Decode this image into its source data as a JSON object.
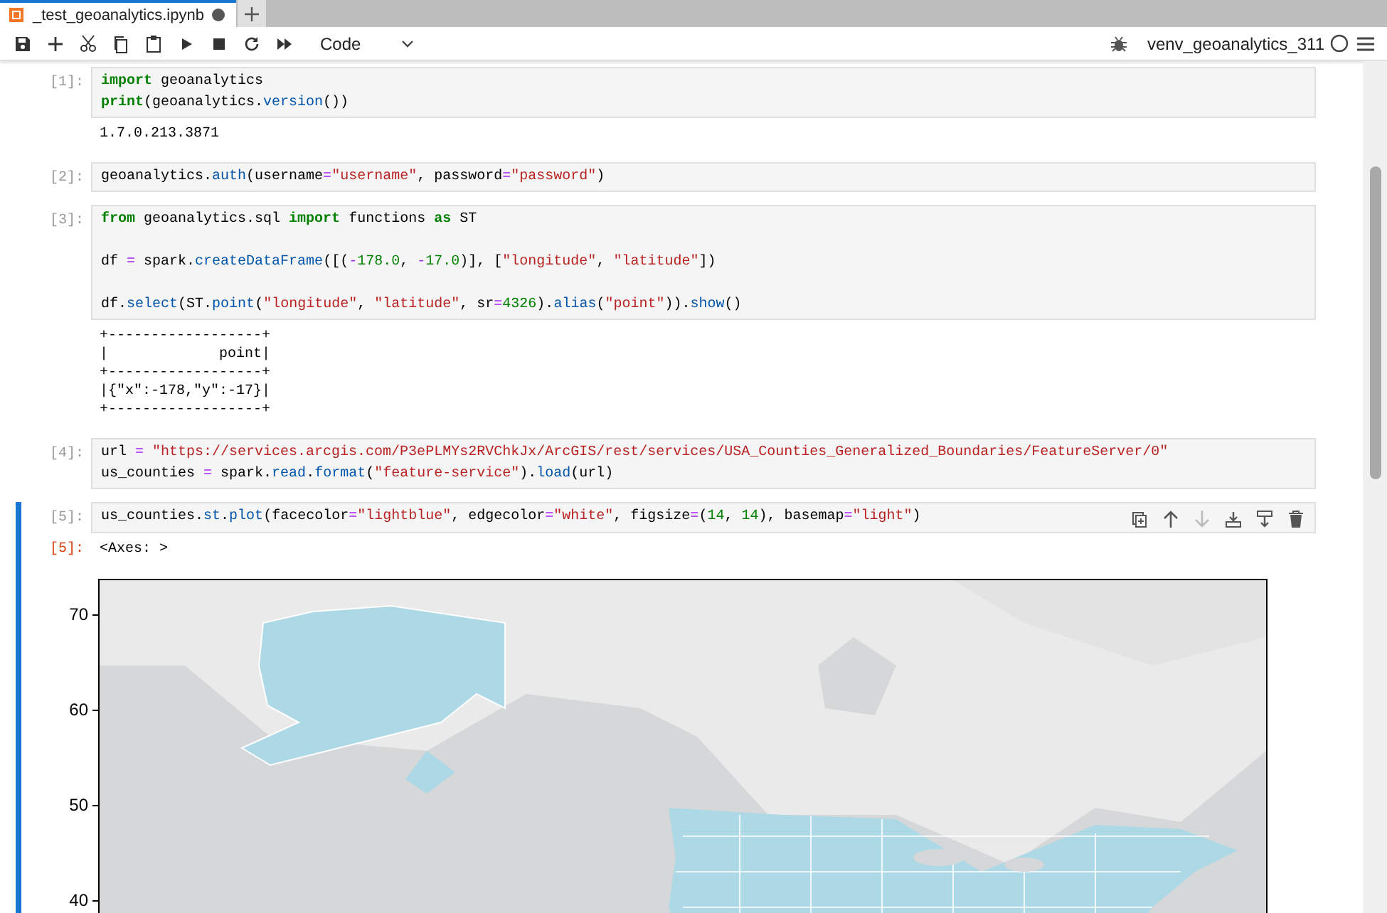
{
  "tabs": [
    {
      "title": "_test_geoanalytics.ipynb",
      "selected": true,
      "modified": true
    }
  ],
  "toolbar": {
    "cell_type": "Code",
    "kernel_name": "venv_geoanalytics_311",
    "kernel_busy": false
  },
  "cells": [
    {
      "prompt": "[1]:",
      "selected": false,
      "lines": [
        {
          "tokens": [
            {
              "kind": "kw",
              "text": "import"
            },
            {
              "kind": "plain",
              "text": " geoanalytics"
            }
          ]
        },
        {
          "tokens": [
            {
              "kind": "kw",
              "text": "print"
            },
            {
              "kind": "plain",
              "text": "(geoanalytics."
            },
            {
              "kind": "fn",
              "text": "version"
            },
            {
              "kind": "plain",
              "text": "())"
            }
          ]
        }
      ],
      "outputs": [
        {
          "kind": "stream",
          "lines": [
            "1.7.0.213.3871"
          ]
        }
      ]
    },
    {
      "prompt": "[2]:",
      "selected": false,
      "lines": [
        {
          "tokens": [
            {
              "kind": "plain",
              "text": "geoanalytics."
            },
            {
              "kind": "fn",
              "text": "auth"
            },
            {
              "kind": "plain",
              "text": "(username"
            },
            {
              "kind": "op",
              "text": "="
            },
            {
              "kind": "str",
              "text": "\"username\""
            },
            {
              "kind": "plain",
              "text": ", password"
            },
            {
              "kind": "op",
              "text": "="
            },
            {
              "kind": "str",
              "text": "\"password\""
            },
            {
              "kind": "plain",
              "text": ")"
            }
          ]
        }
      ]
    },
    {
      "prompt": "[3]:",
      "selected": false,
      "lines": [
        {
          "tokens": [
            {
              "kind": "kw",
              "text": "from"
            },
            {
              "kind": "plain",
              "text": " geoanalytics.sql "
            },
            {
              "kind": "kw",
              "text": "import"
            },
            {
              "kind": "plain",
              "text": " functions "
            },
            {
              "kind": "kw",
              "text": "as"
            },
            {
              "kind": "plain",
              "text": " ST"
            }
          ]
        },
        {
          "gap_before": true,
          "tokens": [
            {
              "kind": "plain",
              "text": "df "
            },
            {
              "kind": "op",
              "text": "="
            },
            {
              "kind": "plain",
              "text": " spark."
            },
            {
              "kind": "fn",
              "text": "createDataFrame"
            },
            {
              "kind": "plain",
              "text": "([("
            },
            {
              "kind": "op",
              "text": "-"
            },
            {
              "kind": "num",
              "text": "178.0"
            },
            {
              "kind": "plain",
              "text": ", "
            },
            {
              "kind": "op",
              "text": "-"
            },
            {
              "kind": "num",
              "text": "17.0"
            },
            {
              "kind": "plain",
              "text": ")], ["
            },
            {
              "kind": "str",
              "text": "\"longitude\""
            },
            {
              "kind": "plain",
              "text": ", "
            },
            {
              "kind": "str",
              "text": "\"latitude\""
            },
            {
              "kind": "plain",
              "text": "])"
            }
          ]
        },
        {
          "gap_before": true,
          "tokens": [
            {
              "kind": "plain",
              "text": "df."
            },
            {
              "kind": "fn",
              "text": "select"
            },
            {
              "kind": "plain",
              "text": "(ST."
            },
            {
              "kind": "fn",
              "text": "point"
            },
            {
              "kind": "plain",
              "text": "("
            },
            {
              "kind": "str",
              "text": "\"longitude\""
            },
            {
              "kind": "plain",
              "text": ", "
            },
            {
              "kind": "str",
              "text": "\"latitude\""
            },
            {
              "kind": "plain",
              "text": ", sr"
            },
            {
              "kind": "op",
              "text": "="
            },
            {
              "kind": "num",
              "text": "4326"
            },
            {
              "kind": "plain",
              "text": ")."
            },
            {
              "kind": "fn",
              "text": "alias"
            },
            {
              "kind": "plain",
              "text": "("
            },
            {
              "kind": "str",
              "text": "\"point\""
            },
            {
              "kind": "plain",
              "text": "))."
            },
            {
              "kind": "fn",
              "text": "show"
            },
            {
              "kind": "plain",
              "text": "()"
            }
          ]
        }
      ],
      "outputs": [
        {
          "kind": "stream",
          "lines": [
            "+------------------+",
            "|             point|",
            "+------------------+",
            "|{\"x\":-178,\"y\":-17}|",
            "+------------------+"
          ]
        }
      ]
    },
    {
      "prompt": "[4]:",
      "selected": false,
      "lines": [
        {
          "tokens": [
            {
              "kind": "plain",
              "text": "url "
            },
            {
              "kind": "op",
              "text": "= "
            },
            {
              "kind": "str",
              "text": "\"https://services.arcgis.com/P3ePLMYs2RVChkJx/ArcGIS/rest/services/USA_Counties_Generalized_Boundaries/FeatureServer/0\""
            }
          ]
        },
        {
          "tokens": [
            {
              "kind": "plain",
              "text": "us_counties "
            },
            {
              "kind": "op",
              "text": "="
            },
            {
              "kind": "plain",
              "text": " spark."
            },
            {
              "kind": "fn",
              "text": "read"
            },
            {
              "kind": "plain",
              "text": "."
            },
            {
              "kind": "fn",
              "text": "format"
            },
            {
              "kind": "plain",
              "text": "("
            },
            {
              "kind": "str",
              "text": "\"feature-service\""
            },
            {
              "kind": "plain",
              "text": ")."
            },
            {
              "kind": "fn",
              "text": "load"
            },
            {
              "kind": "plain",
              "text": "(url)"
            }
          ]
        }
      ]
    },
    {
      "prompt": "[5]:",
      "selected": true,
      "lines": [
        {
          "tokens": [
            {
              "kind": "plain",
              "text": "us_counties."
            },
            {
              "kind": "fn",
              "text": "st"
            },
            {
              "kind": "plain",
              "text": "."
            },
            {
              "kind": "fn",
              "text": "plot"
            },
            {
              "kind": "plain",
              "text": "(facecolor"
            },
            {
              "kind": "op",
              "text": "="
            },
            {
              "kind": "str",
              "text": "\"lightblue\""
            },
            {
              "kind": "plain",
              "text": ", edgecolor"
            },
            {
              "kind": "op",
              "text": "="
            },
            {
              "kind": "str",
              "text": "\"white\""
            },
            {
              "kind": "plain",
              "text": ", figsize"
            },
            {
              "kind": "op",
              "text": "="
            },
            {
              "kind": "plain",
              "text": "("
            },
            {
              "kind": "num",
              "text": "14"
            },
            {
              "kind": "plain",
              "text": ", "
            },
            {
              "kind": "num",
              "text": "14"
            },
            {
              "kind": "plain",
              "text": "), basemap"
            },
            {
              "kind": "op",
              "text": "="
            },
            {
              "kind": "str",
              "text": "\"light\""
            },
            {
              "kind": "plain",
              "text": ")"
            }
          ]
        }
      ],
      "cell_actions": [
        {
          "kind": "duplicate",
          "disabled": false
        },
        {
          "kind": "move-up",
          "disabled": false
        },
        {
          "kind": "move-down",
          "disabled": true
        },
        {
          "kind": "insert-above",
          "disabled": false
        },
        {
          "kind": "insert-below",
          "disabled": false
        },
        {
          "kind": "delete",
          "disabled": false
        }
      ],
      "outputs": [
        {
          "kind": "result",
          "prompt": "[5]:",
          "lines": [
            "<Axes: >"
          ]
        },
        {
          "kind": "plot",
          "y_tick_labels": [
            "70",
            "60",
            "50",
            "40"
          ]
        }
      ]
    }
  ]
}
